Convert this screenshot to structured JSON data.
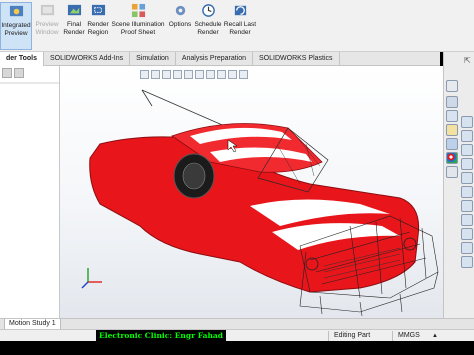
{
  "ribbon": {
    "buttons": [
      {
        "label": "Integrated Preview",
        "active": true,
        "enabled": true
      },
      {
        "label": "Preview Window",
        "active": false,
        "enabled": false
      },
      {
        "label": "Final Render",
        "active": false,
        "enabled": true
      },
      {
        "label": "Render Region",
        "active": false,
        "enabled": true
      },
      {
        "label": "Scene Illumination Proof Sheet",
        "active": false,
        "enabled": true
      },
      {
        "label": "Options",
        "active": false,
        "enabled": true
      },
      {
        "label": "Schedule Render",
        "active": false,
        "enabled": true
      },
      {
        "label": "Recall Last Render",
        "active": false,
        "enabled": true
      }
    ]
  },
  "tabs": [
    {
      "label": "der Tools",
      "active": true
    },
    {
      "label": "SOLIDWORKS Add-Ins",
      "active": false
    },
    {
      "label": "Simulation",
      "active": false
    },
    {
      "label": "Analysis Preparation",
      "active": false
    },
    {
      "label": "SOLIDWORKS Plastics",
      "active": false
    }
  ],
  "viewport": {
    "background_top": "#ffffff",
    "background_bottom": "#e3e7ed",
    "car_color": "#e8151b",
    "stripe_color": "#ffffff",
    "wireframe_color": "#2a2a2a",
    "triad": {
      "x_color": "#e02020",
      "y_color": "#20a020",
      "z_color": "#2040d0"
    }
  },
  "right_panel": {
    "icons": [
      "home-icon",
      "parts-icon",
      "library-icon",
      "file-explorer-icon",
      "view-palette-icon",
      "appearances-icon",
      "custom-properties-icon"
    ]
  },
  "bottom": {
    "motion_tab": "Motion Study 1"
  },
  "status": {
    "credit": "Electronic Clinic:  Engr Fahad",
    "mode": "Editing Part",
    "units": "MMGS",
    "arrow": "▲"
  }
}
